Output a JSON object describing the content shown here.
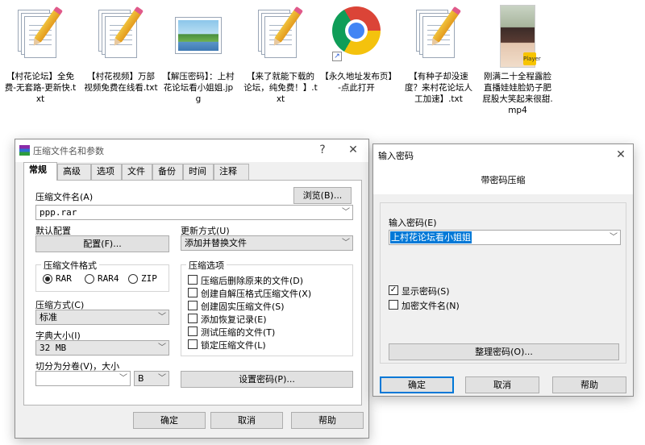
{
  "desktop": {
    "icons": [
      {
        "label": "【村花论坛】全免费-无套路-更新快.txt",
        "icon": "text-file-icon"
      },
      {
        "label": "【村花视频】万部视频免费在线看.txt",
        "icon": "text-file-icon"
      },
      {
        "label": "【解压密码】：上村花论坛看小姐姐.jpg",
        "icon": "image-file-icon"
      },
      {
        "label": "【来了就能下载的论坛，纯免费！】.txt",
        "icon": "text-file-icon"
      },
      {
        "label": "【永久地址发布页】-点此打开",
        "icon": "chrome-icon"
      },
      {
        "label": "【有种子却没速度？来村花论坛人工加速】.txt",
        "icon": "text-file-icon"
      },
      {
        "label": "刚满二十全程露脸直播娃娃脸奶子肥屁股大笑起来很甜.mp4",
        "icon": "video-file-icon"
      }
    ],
    "mp4_badge": "Player"
  },
  "compress_dialog": {
    "title": "压缩文件名和参数",
    "help_glyph": "?",
    "close_glyph": "✕",
    "tabs": [
      "常规",
      "高级",
      "选项",
      "文件",
      "备份",
      "时间",
      "注释"
    ],
    "archive_name_label": "压缩文件名(A)",
    "browse_button": "浏览(B)...",
    "archive_name_value": "ppp.rar",
    "default_profile_label": "默认配置",
    "profile_button": "配置(F)...",
    "update_mode_label": "更新方式(U)",
    "update_mode_value": "添加并替换文件",
    "format_group_title": "压缩文件格式",
    "formats": [
      "RAR",
      "RAR4",
      "ZIP"
    ],
    "selected_format": "RAR",
    "method_label": "压缩方式(C)",
    "method_value": "标准",
    "dict_label": "字典大小(I)",
    "dict_value": "32 MB",
    "split_label": "切分为分卷(V)，大小",
    "split_value": "",
    "split_unit": "B",
    "options_group_title": "压缩选项",
    "options": [
      {
        "label": "压缩后删除原来的文件(D)",
        "checked": false
      },
      {
        "label": "创建自解压格式压缩文件(X)",
        "checked": false
      },
      {
        "label": "创建固实压缩文件(S)",
        "checked": false
      },
      {
        "label": "添加恢复记录(E)",
        "checked": false
      },
      {
        "label": "测试压缩的文件(T)",
        "checked": false
      },
      {
        "label": "锁定压缩文件(L)",
        "checked": false
      }
    ],
    "set_password_button": "设置密码(P)...",
    "ok_button": "确定",
    "cancel_button": "取消",
    "help_button": "帮助"
  },
  "password_dialog": {
    "title": "输入密码",
    "close_glyph": "✕",
    "subtitle": "带密码压缩",
    "enter_password_label": "输入密码(E)",
    "password_value": "上村花论坛看小姐姐",
    "show_password_label": "显示密码(S)",
    "show_password_checked": true,
    "encrypt_names_label": "加密文件名(N)",
    "encrypt_names_checked": false,
    "organize_button": "整理密码(O)...",
    "ok_button": "确定",
    "cancel_button": "取消",
    "help_button": "帮助"
  },
  "colors": {
    "selection_blue": "#0078d7",
    "dialog_bg": "#f0f0f0"
  }
}
